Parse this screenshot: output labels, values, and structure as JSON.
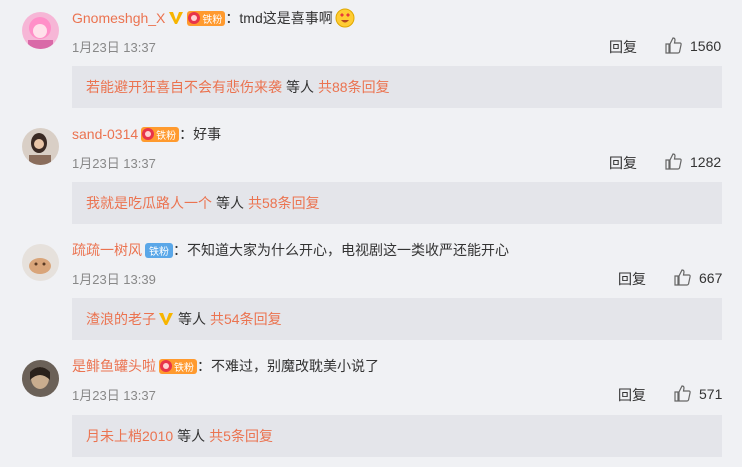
{
  "comments": [
    {
      "username": "Gnomeshgh_X",
      "verified": true,
      "fan_badge": "铁粉",
      "colon": "：",
      "text": "tmd这是喜事啊",
      "emoji": "heart-eyes-emoji",
      "date": "1月23日 13:37",
      "reply_label": "回复",
      "likes": "1560",
      "sub": {
        "name": "若能避开狂喜自不会有悲伤来袭",
        "verified": false,
        "etc": "等人",
        "total": "共88条回复"
      }
    },
    {
      "username": "sand-0314",
      "verified": false,
      "fan_badge": "铁粉",
      "colon": "：",
      "text": "好事",
      "date": "1月23日 13:37",
      "reply_label": "回复",
      "likes": "1282",
      "sub": {
        "name": "我就是吃瓜路人一个",
        "verified": false,
        "etc": "等人",
        "total": "共58条回复"
      }
    },
    {
      "username": "疏疏一树风",
      "verified": false,
      "fan_badge": "铁粉",
      "colon": "：",
      "text": "不知道大家为什么开心，电视剧这一类收严还能开心",
      "date": "1月23日 13:39",
      "reply_label": "回复",
      "likes": "667",
      "sub": {
        "name": "渣浪的老子",
        "verified": true,
        "etc": "等人",
        "total": "共54条回复"
      }
    },
    {
      "username": "是鲱鱼罐头啦",
      "verified": false,
      "fan_badge": "铁粉",
      "colon": "：",
      "text": "不难过，别魔改耽美小说了",
      "date": "1月23日 13:37",
      "reply_label": "回复",
      "likes": "571",
      "sub": {
        "name": "月未上梢2010",
        "verified": false,
        "etc": "等人",
        "total": "共5条回复"
      }
    }
  ],
  "colors": {
    "accent": "#eb7350",
    "background": "#f0f1f4",
    "subbox": "#e4e5ea"
  }
}
